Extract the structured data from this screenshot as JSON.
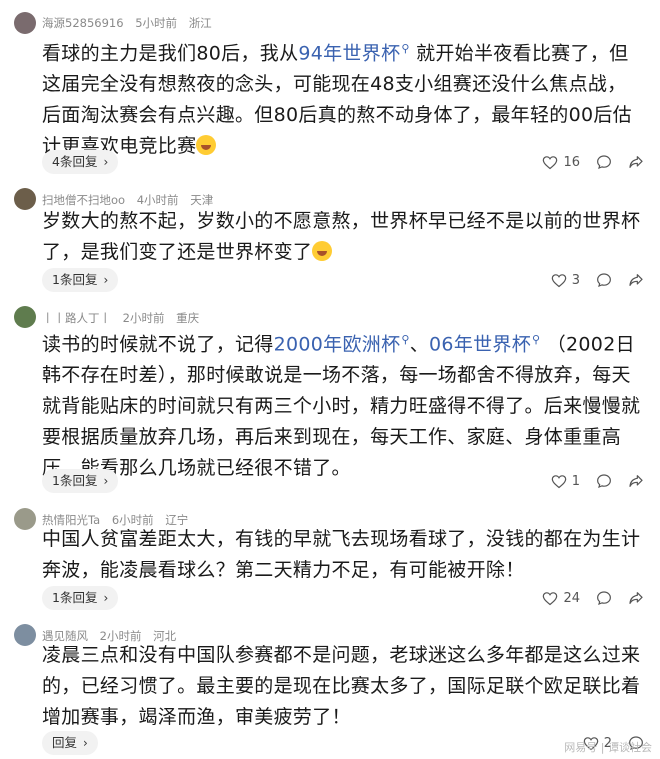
{
  "comments": [
    {
      "user": "海源52856916",
      "time": "5小时前",
      "location": "浙江",
      "body_parts": [
        {
          "text": "看球的主力是我们80后，我从",
          "link": false
        },
        {
          "text": "94年世界杯",
          "link": true
        },
        {
          "text": " 就开始半夜看比赛了，但这届完全没有想熬夜的念头，可能现在48支小组赛还没什么焦点战，后面淘汰赛会有点兴趣。但80后真的熬不动身体了，最年轻的00后估计更喜欢电竞比赛",
          "link": false
        }
      ],
      "emoji": "laughing-crying",
      "reply_label": "4条回复",
      "likes": "16"
    },
    {
      "user": "扫地僧不扫地oo",
      "time": "4小时前",
      "location": "天津",
      "body_parts": [
        {
          "text": "岁数大的熬不起，岁数小的不愿意熬，世界杯早已经不是以前的世界杯了，是我们变了还是世界杯变了",
          "link": false
        }
      ],
      "emoji": "thinking",
      "reply_label": "1条回复",
      "likes": "3"
    },
    {
      "user": "丨丨路人丁丨",
      "time": "2小时前",
      "location": "重庆",
      "body_parts": [
        {
          "text": "读书的时候就不说了，记得",
          "link": false
        },
        {
          "text": "2000年欧洲杯",
          "link": true
        },
        {
          "text": "、",
          "link": false
        },
        {
          "text": "06年世界杯",
          "link": true
        },
        {
          "text": " （2002日韩不存在时差），那时候敢说是一场不落，每一场都舍不得放弃，每天就背能贴床的时间就只有两三个小时，精力旺盛得不得了。后来慢慢就要根据质量放弃几场，再后来到现在，每天工作、家庭、身体重重高压，能看那么几场就已经很不错了。",
          "link": false
        }
      ],
      "emoji": "",
      "reply_label": "1条回复",
      "likes": "1"
    },
    {
      "user": "热情阳光Ta",
      "time": "6小时前",
      "location": "辽宁",
      "body_parts": [
        {
          "text": "中国人贫富差距太大，有钱的早就飞去现场看球了，没钱的都在为生计奔波，能凌晨看球么？第二天精力不足，有可能被开除！",
          "link": false
        }
      ],
      "emoji": "",
      "reply_label": "1条回复",
      "likes": "24"
    },
    {
      "user": "遇见随风",
      "time": "2小时前",
      "location": "河北",
      "body_parts": [
        {
          "text": "凌晨三点和没有中国队参赛都不是问题，老球迷这么多年都是这么过来的，已经习惯了。最主要的是现在比赛太多了，国际足联个欧足联比着增加赛事，竭泽而渔，审美疲劳了！",
          "link": false
        }
      ],
      "emoji": "",
      "reply_label": "回复",
      "likes": "2"
    }
  ],
  "watermark": "网易号 | 谭谈社会",
  "colors": {
    "link": "#3a62b0",
    "meta": "#8a8a8a",
    "reply_bg": "#f2f2f2"
  }
}
